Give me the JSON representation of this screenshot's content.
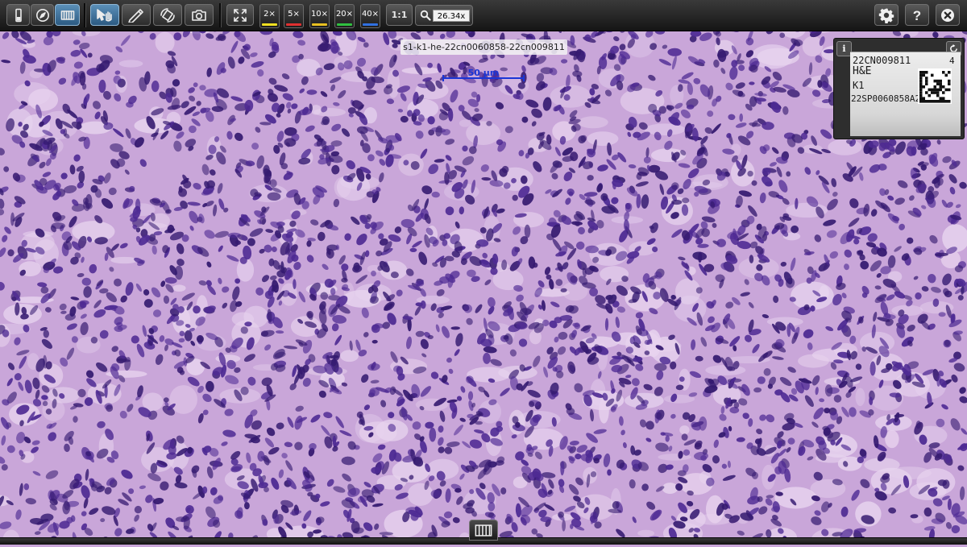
{
  "toolbar": {
    "left_tools": [
      {
        "name": "slide-overview-icon",
        "active": false
      },
      {
        "name": "compass-icon",
        "active": false
      },
      {
        "name": "thumbnail-strip-icon",
        "active": true
      },
      {
        "name": "pan-hand-icon",
        "active": true
      },
      {
        "name": "pen-icon",
        "active": false
      },
      {
        "name": "rotate-icon",
        "active": false
      },
      {
        "name": "camera-icon",
        "active": false
      }
    ],
    "fullscreen_icon": "fullscreen-icon",
    "zoom_presets": [
      {
        "label": "2×",
        "color": "#f0e020"
      },
      {
        "label": "5×",
        "color": "#e03030"
      },
      {
        "label": "10×",
        "color": "#e8c020"
      },
      {
        "label": "20×",
        "color": "#30c040"
      },
      {
        "label": "40×",
        "color": "#3070e0"
      }
    ],
    "one_to_one_label": "1:1",
    "zoom_value": "26.34x",
    "right_tools": [
      "settings-gear-icon",
      "help-question-icon",
      "close-icon"
    ]
  },
  "slide": {
    "name": "s1-k1-he-22cn0060858-22cn009811",
    "scale_label": "50 µm",
    "scale_color": "#1a35d6",
    "stain_colors": {
      "background": "#c9a6d9",
      "stroma": "#e7d3ee",
      "nucleus": "#4e2a93",
      "nucleus_dark": "#351a70"
    }
  },
  "label_panel": {
    "line1": "22CN009811",
    "line1_suffix": "4",
    "line2": "H&E",
    "line3": "K1",
    "line4": "22SP0060858A2"
  },
  "bottom": {
    "thumbnails_icon": "thumbnails-icon"
  }
}
